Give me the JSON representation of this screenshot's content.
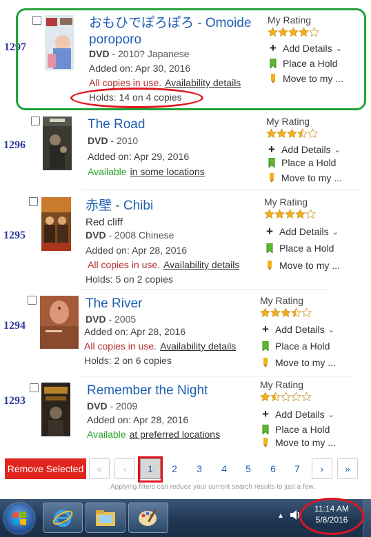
{
  "items": [
    {
      "number": "1297",
      "title": "おもひでぽろぽろ - Omoide poroporo",
      "title_line1": "おもひでぽろぽろ - Omoide",
      "title_line2": "poroporo",
      "subtitle": "",
      "format": "DVD",
      "format_detail": " - 2010? Japanese",
      "added": "Added on: Apr 30, 2016",
      "status": "All copies in use.",
      "status_kind": "red",
      "status_link": "Availability details",
      "holds": "Holds: 14 on 4 copies",
      "rating_label": "My Rating",
      "rating": 4,
      "poster": "omoide-poster"
    },
    {
      "number": "1296",
      "title": "The Road",
      "subtitle": "",
      "format": "DVD",
      "format_detail": " - 2010",
      "added": "Added on: Apr 29, 2016",
      "status": "Available",
      "status_kind": "green",
      "status_link": "in some locations",
      "holds": "",
      "rating_label": "My Rating",
      "rating": 3.5,
      "poster": "the-road-poster"
    },
    {
      "number": "1295",
      "title": "赤壁 - Chibi",
      "subtitle": "Red cliff",
      "format": "DVD",
      "format_detail": " - 2008 Chinese",
      "added": "Added on: Apr 28, 2016",
      "status": "All copies in use.",
      "status_kind": "red",
      "status_link": "Availability details",
      "holds": "Holds: 5 on 2 copies",
      "rating_label": "My Rating",
      "rating": 4,
      "poster": "red-cliff-poster"
    },
    {
      "number": "1294",
      "title": "The River",
      "subtitle": "",
      "format": "DVD",
      "format_detail": " - 2005",
      "added": "Added on: Apr 28, 2016",
      "status": "All copies in use.",
      "status_kind": "red",
      "status_link": "Availability details",
      "holds": "Holds: 2 on 6 copies",
      "rating_label": "My Rating",
      "rating": 3.5,
      "poster": "the-river-poster"
    },
    {
      "number": "1293",
      "title": "Remember the Night",
      "subtitle": "",
      "format": "DVD",
      "format_detail": " - 2009",
      "added": "Added on: Apr 28, 2016",
      "status": "Available",
      "status_kind": "green",
      "status_link": "at preferred locations",
      "holds": "",
      "rating_label": "My Rating",
      "rating": 1.5,
      "poster": "remember-the-night-poster"
    }
  ],
  "actions": {
    "add_details": "Add Details",
    "place_hold": "Place a Hold",
    "move_to": "Move to my ..."
  },
  "pager": {
    "remove_selected": "Remove Selected",
    "first": "«",
    "prev": "‹",
    "pages": [
      "1",
      "2",
      "3",
      "4",
      "5",
      "6",
      "7"
    ],
    "current_page": "1",
    "next": "›",
    "last": "»",
    "hint": "Applying filters can reduce your current search results to just a few."
  },
  "taskbar": {
    "time": "11:14 AM",
    "date": "5/8/2016",
    "apps": [
      "internet-explorer-icon",
      "file-explorer-icon",
      "paint-icon"
    ]
  },
  "colors": {
    "title_link": "#1e5fb4",
    "unavailable": "#b42a2a",
    "available": "#2ea32e",
    "star": "#f2b01e",
    "annotation_green": "#22a23a",
    "annotation_red": "#e0141e",
    "remove_button": "#e0241e"
  }
}
